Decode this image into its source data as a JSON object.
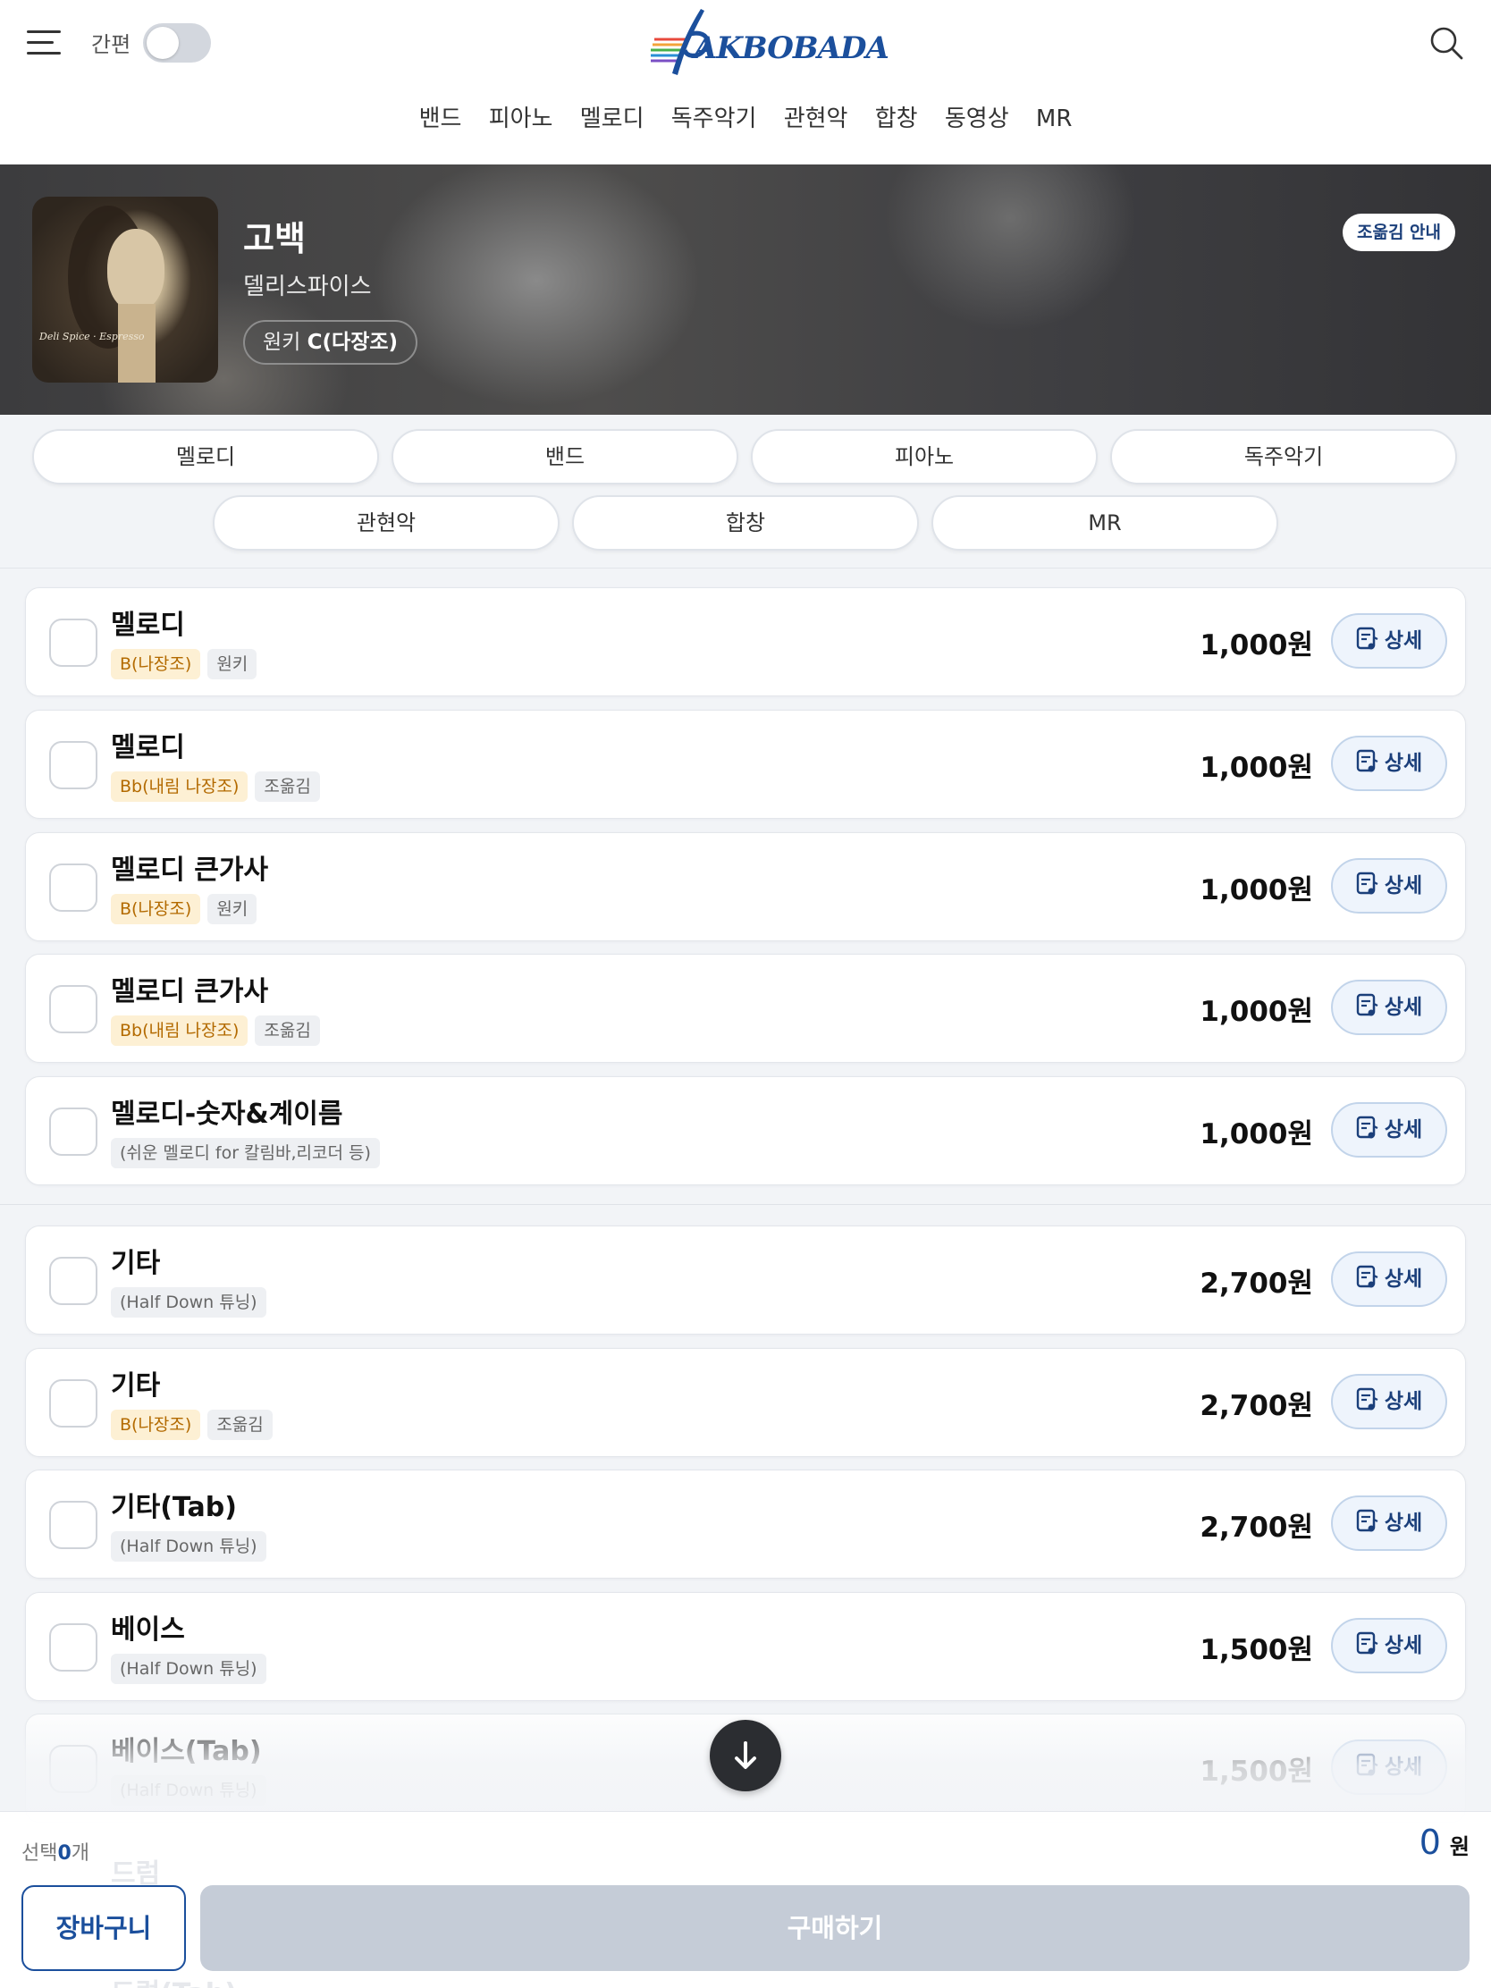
{
  "header": {
    "simple_label": "간편",
    "logo_text": "AKBOBADA",
    "nav": [
      "밴드",
      "피아노",
      "멜로디",
      "독주악기",
      "관현악",
      "합창",
      "동영상",
      "MR"
    ]
  },
  "song": {
    "title": "고백",
    "artist": "델리스파이스",
    "key_prefix": "원키",
    "key_value": "C(다장조)",
    "transpose_button": "조옮김 안내",
    "cover_signature": "Deli Spice · Espresso"
  },
  "categories": [
    "멜로디",
    "밴드",
    "피아노",
    "독주악기",
    "관현악",
    "합창",
    "MR"
  ],
  "items": [
    {
      "name": "멜로디",
      "tags": [
        {
          "text": "B(나장조)",
          "type": "key"
        },
        {
          "text": "원키",
          "type": "gray"
        }
      ],
      "price": "1,000원",
      "detail": "상세"
    },
    {
      "name": "멜로디",
      "tags": [
        {
          "text": "Bb(내림 나장조)",
          "type": "key"
        },
        {
          "text": "조옮김",
          "type": "gray"
        }
      ],
      "price": "1,000원",
      "detail": "상세"
    },
    {
      "name": "멜로디 큰가사",
      "tags": [
        {
          "text": "B(나장조)",
          "type": "key"
        },
        {
          "text": "원키",
          "type": "gray"
        }
      ],
      "price": "1,000원",
      "detail": "상세"
    },
    {
      "name": "멜로디 큰가사",
      "tags": [
        {
          "text": "Bb(내림 나장조)",
          "type": "key"
        },
        {
          "text": "조옮김",
          "type": "gray"
        }
      ],
      "price": "1,000원",
      "detail": "상세"
    },
    {
      "name": "멜로디-숫자&계이름",
      "tags": [
        {
          "text": "(쉬운 멜로디 for 칼림바,리코더 등)",
          "type": "gray"
        }
      ],
      "price": "1,000원",
      "detail": "상세"
    },
    {
      "name": "기타",
      "tags": [
        {
          "text": "(Half Down 튜닝)",
          "type": "gray"
        }
      ],
      "price": "2,700원",
      "detail": "상세"
    },
    {
      "name": "기타",
      "tags": [
        {
          "text": "B(나장조)",
          "type": "key"
        },
        {
          "text": "조옮김",
          "type": "gray"
        }
      ],
      "price": "2,700원",
      "detail": "상세"
    },
    {
      "name": "기타(Tab)",
      "tags": [
        {
          "text": "(Half Down 튜닝)",
          "type": "gray"
        }
      ],
      "price": "2,700원",
      "detail": "상세"
    },
    {
      "name": "베이스",
      "tags": [
        {
          "text": "(Half Down 튜닝)",
          "type": "gray"
        }
      ],
      "price": "1,500원",
      "detail": "상세"
    },
    {
      "name": "베이스(Tab)",
      "tags": [
        {
          "text": "(Half Down 튜닝)",
          "type": "gray"
        }
      ],
      "price": "1,500원",
      "detail": "상세"
    }
  ],
  "hidden_items": [
    "드럼",
    "드럼(Tab)"
  ],
  "bottom": {
    "selected_prefix": "선택",
    "selected_count": "0",
    "selected_suffix": "개",
    "total_value": "0",
    "total_unit": "원",
    "cart_button": "장바구니",
    "buy_button": "구매하기"
  },
  "colors": {
    "brand": "#1b4f9c",
    "key_tag_bg": "#fdf0d4",
    "key_tag_text": "#b36a00",
    "buy_disabled": "#c5ccd7"
  }
}
